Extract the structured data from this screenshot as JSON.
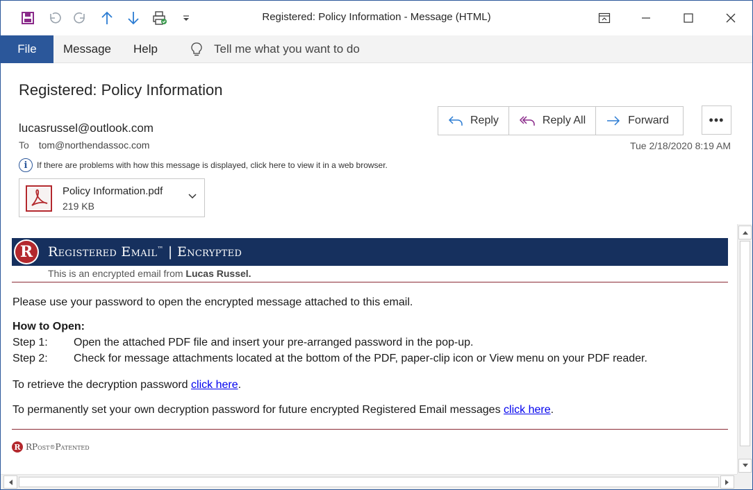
{
  "window": {
    "title": "Registered: Policy Information  -  Message (HTML)"
  },
  "ribbon": {
    "tabs": [
      "File",
      "Message",
      "Help"
    ],
    "tell_me": "Tell me what you want to do"
  },
  "message": {
    "subject": "Registered: Policy Information",
    "from": "lucasrussel@outlook.com",
    "to_label": "To",
    "to": "tom@northendassoc.com",
    "date": "Tue 2/18/2020 8:19 AM",
    "info_bar": "If there are problems with how this message is displayed, click here to view it in a web browser."
  },
  "actions": {
    "reply": "Reply",
    "reply_all": "Reply All",
    "forward": "Forward",
    "more": "•••"
  },
  "attachment": {
    "name": "Policy Information.pdf",
    "size": "219 KB"
  },
  "body": {
    "banner_logo": "R",
    "banner_title_1": "Registered Email",
    "banner_tm": "™",
    "banner_sep": " | ",
    "banner_title_2": "Encrypted",
    "encrypted_from_prefix": "This is an encrypted email from ",
    "encrypted_from_name": "Lucas Russel.",
    "intro": "Please use your password to open the encrypted message attached to this email.",
    "how_to": "How to Open:",
    "steps": [
      {
        "label": "Step 1:",
        "text": "Open the attached PDF file and insert your pre-arranged password in the pop-up."
      },
      {
        "label": "Step 2:",
        "text": "Check for message attachments located at the bottom of the PDF, paper-clip icon or View menu on your PDF reader."
      }
    ],
    "retrieve_prefix": "To retrieve the decryption password ",
    "retrieve_link": "click here",
    "retrieve_suffix": ".",
    "permanent_prefix": "To permanently set your own decryption password for future encrypted Registered Email messages ",
    "permanent_link": "click here",
    "permanent_suffix": ".",
    "footer_logo": "R",
    "footer_text": "RPost",
    "footer_reg": "®",
    "footer_patented": " Patented"
  },
  "colors": {
    "accent": "#2b579a",
    "banner": "#16305e",
    "rule": "#8b2a35",
    "link": "#0000ee",
    "rpost_red": "#b3282d"
  }
}
